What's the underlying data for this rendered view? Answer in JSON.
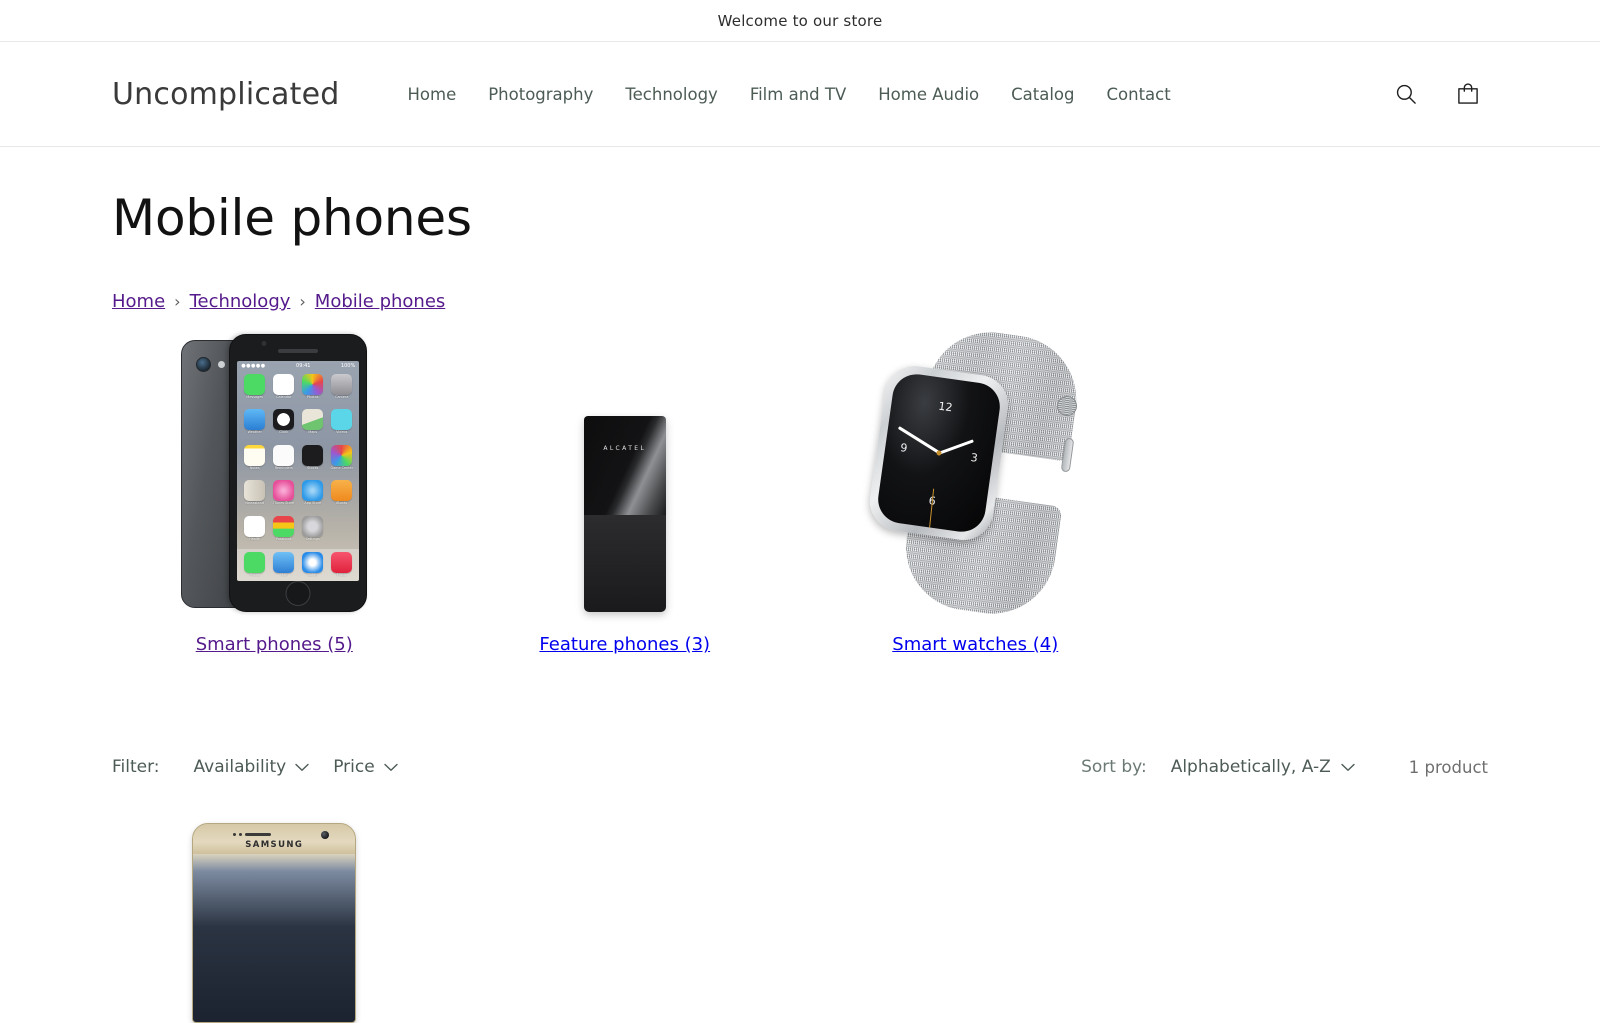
{
  "announcement": {
    "text": "Welcome to our store"
  },
  "header": {
    "logo": "Uncomplicated",
    "nav": [
      {
        "label": "Home"
      },
      {
        "label": "Photography"
      },
      {
        "label": "Technology"
      },
      {
        "label": "Film and TV"
      },
      {
        "label": "Home Audio"
      },
      {
        "label": "Catalog"
      },
      {
        "label": "Contact"
      }
    ],
    "actions": {
      "search_icon": "search-icon",
      "cart_icon": "shopping-bag-icon"
    }
  },
  "main": {
    "page_title": "Mobile phones",
    "breadcrumb": {
      "separator": "›",
      "items": [
        {
          "label": "Home",
          "state": "visited"
        },
        {
          "label": "Technology",
          "state": "visited"
        },
        {
          "label": "Mobile phones",
          "state": "visited"
        }
      ]
    },
    "subcollections": [
      {
        "title": "Smart phones (5)",
        "state": "visited",
        "image": "iphone-5s-space-gray",
        "phone_ui": {
          "status_signal": "●●●●●",
          "status_time": "09:41",
          "status_battery": "100%",
          "apps": [
            {
              "label": "Messages",
              "color": "#4cd964"
            },
            {
              "label": "Calendar",
              "color": "#ffffff"
            },
            {
              "label": "Photos",
              "color": "#f2f2f2"
            },
            {
              "label": "Camera",
              "color": "#8e8e93"
            },
            {
              "label": "Weather",
              "color": "#4a9fe8"
            },
            {
              "label": "Clock",
              "color": "#1c1c1e"
            },
            {
              "label": "Maps",
              "color": "#e9e5d8"
            },
            {
              "label": "Videos",
              "color": "#5ad6e8"
            },
            {
              "label": "Notes",
              "color": "#ffd83d"
            },
            {
              "label": "Reminders",
              "color": "#fbfbfb"
            },
            {
              "label": "Stocks",
              "color": "#1c1c1e"
            },
            {
              "label": "Game Center",
              "color": "#f7f7f7"
            },
            {
              "label": "Newsstand",
              "color": "#e8e3d8"
            },
            {
              "label": "iTunes Store",
              "color": "#e6509a"
            },
            {
              "label": "App Store",
              "color": "#2f9ae8"
            },
            {
              "label": "iBooks",
              "color": "#f5952a"
            },
            {
              "label": "Health",
              "color": "#ffffff"
            },
            {
              "label": "Passbook",
              "color": "#f0f0f0"
            },
            {
              "label": "Settings",
              "color": "#9b9b9b"
            }
          ],
          "dock": [
            {
              "label": "Phone",
              "color": "#4cd964"
            },
            {
              "label": "Mail",
              "color": "#3b9ae8"
            },
            {
              "label": "Safari",
              "color": "#2b8ce8"
            },
            {
              "label": "Music",
              "color": "#f23b52"
            }
          ]
        }
      },
      {
        "title": "Feature phones (3)",
        "state": "unvisited",
        "image": "alcatel-feature-phone",
        "brand": "ALCATEL"
      },
      {
        "title": "Smart watches (4)",
        "state": "unvisited",
        "image": "apple-watch-milanese-loop",
        "watch_face": {
          "numerals": [
            "12",
            "3",
            "6",
            "9"
          ]
        }
      }
    ],
    "facets": {
      "filter_label": "Filter:",
      "items": [
        {
          "label": "Availability",
          "icon": "chevron-down-icon"
        },
        {
          "label": "Price",
          "icon": "chevron-down-icon"
        }
      ],
      "sort_label": "Sort by:",
      "sort_value": "Alphabetically, A-Z",
      "sort_icon": "chevron-down-icon",
      "product_count": "1 product"
    },
    "products": [
      {
        "image": "samsung-galaxy-gold",
        "brand": "SAMSUNG"
      }
    ]
  },
  "colors": {
    "text": "#121212",
    "nav_text": "#4c5c54",
    "link_visited": "#551a8b",
    "link_unvisited": "#0000ee",
    "border": "#e8e8e8",
    "background": "#ffffff"
  }
}
